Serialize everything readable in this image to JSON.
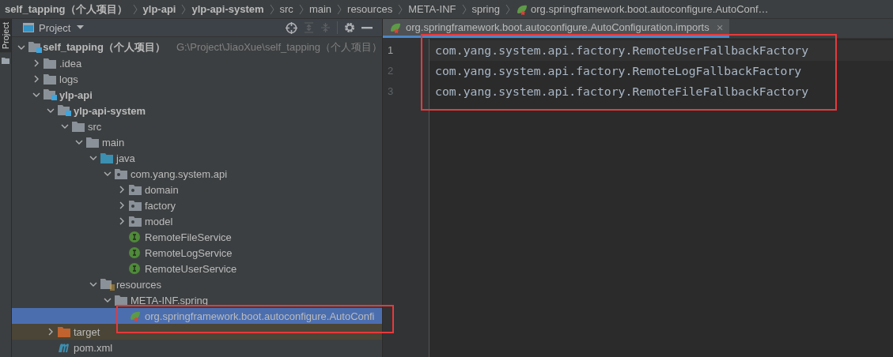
{
  "breadcrumb": [
    {
      "label": "self_tapping（个人项目）",
      "bold": true,
      "kind": "text"
    },
    {
      "label": "ylp-api",
      "bold": true,
      "kind": "text"
    },
    {
      "label": "ylp-api-system",
      "bold": true,
      "kind": "text"
    },
    {
      "label": "src",
      "bold": false,
      "kind": "text"
    },
    {
      "label": "main",
      "bold": false,
      "kind": "text"
    },
    {
      "label": "resources",
      "bold": false,
      "kind": "text"
    },
    {
      "label": "META-INF",
      "bold": false,
      "kind": "text"
    },
    {
      "label": "spring",
      "bold": false,
      "kind": "text"
    },
    {
      "label": "org.springframework.boot.autoconfigure.AutoConf…",
      "bold": false,
      "kind": "spring-file"
    }
  ],
  "tool_strip": {
    "label": "Project"
  },
  "project_panel": {
    "title": "Project",
    "tree": [
      {
        "label": "self_tapping（个人项目）",
        "path": "G:\\Project\\JiaoXue\\self_tapping（个人项目）",
        "kind": "module",
        "bold": true,
        "expanded": true,
        "selected": false,
        "children": [
          {
            "label": ".idea",
            "kind": "folder",
            "bold": false,
            "expanded": false,
            "selected": false
          },
          {
            "label": "logs",
            "kind": "folder",
            "bold": false,
            "expanded": false,
            "selected": false
          },
          {
            "label": "ylp-api",
            "kind": "module",
            "bold": true,
            "expanded": true,
            "selected": false,
            "children": [
              {
                "label": "ylp-api-system",
                "kind": "module",
                "bold": true,
                "expanded": true,
                "selected": false,
                "children": [
                  {
                    "label": "src",
                    "kind": "folder",
                    "bold": false,
                    "expanded": true,
                    "selected": false,
                    "children": [
                      {
                        "label": "main",
                        "kind": "folder",
                        "bold": false,
                        "expanded": true,
                        "selected": false,
                        "children": [
                          {
                            "label": "java",
                            "kind": "source-folder",
                            "bold": false,
                            "expanded": true,
                            "selected": false,
                            "children": [
                              {
                                "label": "com.yang.system.api",
                                "kind": "package",
                                "bold": false,
                                "expanded": true,
                                "selected": false,
                                "children": [
                                  {
                                    "label": "domain",
                                    "kind": "package",
                                    "bold": false,
                                    "expanded": false,
                                    "selected": false
                                  },
                                  {
                                    "label": "factory",
                                    "kind": "package",
                                    "bold": false,
                                    "expanded": false,
                                    "selected": false
                                  },
                                  {
                                    "label": "model",
                                    "kind": "package",
                                    "bold": false,
                                    "expanded": false,
                                    "selected": false
                                  },
                                  {
                                    "label": "RemoteFileService",
                                    "kind": "interface",
                                    "bold": false,
                                    "selected": false
                                  },
                                  {
                                    "label": "RemoteLogService",
                                    "kind": "interface",
                                    "bold": false,
                                    "selected": false
                                  },
                                  {
                                    "label": "RemoteUserService",
                                    "kind": "interface",
                                    "bold": false,
                                    "selected": false
                                  }
                                ]
                              }
                            ]
                          },
                          {
                            "label": "resources",
                            "kind": "resources",
                            "bold": false,
                            "expanded": true,
                            "selected": false,
                            "children": [
                              {
                                "label": "META-INF.spring",
                                "kind": "folder",
                                "bold": false,
                                "expanded": true,
                                "selected": false,
                                "children": [
                                  {
                                    "label": "org.springframework.boot.autoconfigure.AutoConfi",
                                    "kind": "spring-file",
                                    "bold": false,
                                    "selected": true,
                                    "highlighted": true
                                  }
                                ]
                              }
                            ]
                          }
                        ]
                      }
                    ]
                  }
                ]
              },
              {
                "label": "target",
                "kind": "excluded-folder",
                "bold": false,
                "expanded": false,
                "selected": false
              },
              {
                "label": "pom.xml",
                "kind": "maven",
                "bold": false,
                "selected": false
              }
            ]
          }
        ]
      }
    ]
  },
  "editor": {
    "tab": {
      "label": "org.springframework.boot.autoconfigure.AutoConfiguration.imports",
      "close": "×"
    },
    "highlighted": true,
    "lines": [
      {
        "number": "1",
        "text": "com.yang.system.api.factory.RemoteUserFallbackFactory",
        "current": true
      },
      {
        "number": "2",
        "text": "com.yang.system.api.factory.RemoteLogFallbackFactory",
        "current": false
      },
      {
        "number": "3",
        "text": "com.yang.system.api.factory.RemoteFileFallbackFactory",
        "current": false
      }
    ]
  }
}
